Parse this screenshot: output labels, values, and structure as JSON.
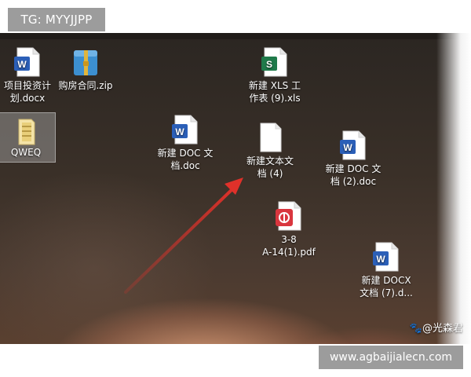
{
  "overlay": {
    "top_label": "TG: MYYJJPP",
    "bottom_label": "www.agbaijialecn.com"
  },
  "watermark": "🐾@光森君",
  "desktop": {
    "icons": [
      {
        "label": "项目投资计\n划.docx",
        "type": "word"
      },
      {
        "label": "购房合同.zip",
        "type": "zip"
      },
      {
        "label": "QWEQ",
        "type": "folder"
      },
      {
        "label": "新建 XLS 工\n作表 (9).xls",
        "type": "excel"
      },
      {
        "label": "新建 DOC 文\n档.doc",
        "type": "word"
      },
      {
        "label": "新建文本文\n档 (4)",
        "type": "text"
      },
      {
        "label": "新建 DOC 文\n档 (2).doc",
        "type": "word"
      },
      {
        "label": "3-8\nA-14(1).pdf",
        "type": "pdf"
      },
      {
        "label": "新建 DOCX\n文档 (7).d...",
        "type": "word"
      }
    ]
  },
  "colors": {
    "word": "#2b5fb8",
    "excel": "#1f7a4a",
    "pdf": "#d9363e",
    "zip": "#3c8fd0",
    "folder": "#e9cf7a",
    "arrow": "#e0312a"
  }
}
